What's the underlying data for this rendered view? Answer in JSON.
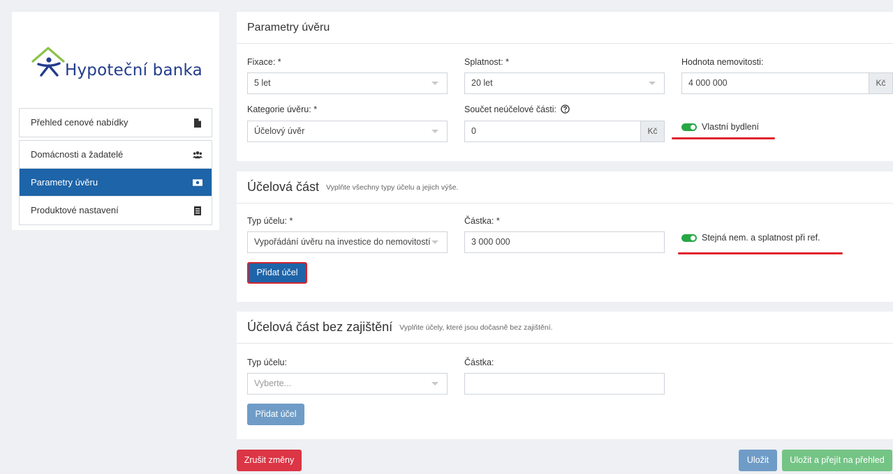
{
  "brand": {
    "name": "Hypoteční banka"
  },
  "sidebar": {
    "overview": {
      "label": "Přehled cenové nabídky",
      "icon": "document-icon"
    },
    "items": [
      {
        "label": "Domácnosti a žadatelé",
        "icon": "users-icon"
      },
      {
        "label": "Parametry úvěru",
        "icon": "money-icon",
        "active": true
      },
      {
        "label": "Produktové nastavení",
        "icon": "list-document-icon"
      }
    ]
  },
  "params": {
    "title": "Parametry úvěru",
    "fixace": {
      "label": "Fixace: *",
      "value": "5 let"
    },
    "splatnost": {
      "label": "Splatnost: *",
      "value": "20 let"
    },
    "hodnota": {
      "label": "Hodnota nemovitosti:",
      "value": "4 000 000",
      "currency": "Kč"
    },
    "kategorie": {
      "label": "Kategorie úvěru: *",
      "value": "Účelový úvěr"
    },
    "soucet": {
      "label": "Součet neúčelové části:",
      "value": "0",
      "currency": "Kč"
    },
    "own_housing": {
      "label": "Vlastní bydlení",
      "on": true
    }
  },
  "purpose": {
    "title": "Účelová část",
    "subtitle": "Vyplňte všechny typy účelu a jejich výše.",
    "type": {
      "label": "Typ účelu: *",
      "value": "Vypořádání úvěru na investice do nemovitostí"
    },
    "amount": {
      "label": "Částka: *",
      "value": "3 000 000"
    },
    "same_toggle": {
      "label": "Stejná nem. a splatnost při ref.",
      "on": true
    },
    "add_button": "Přidat účel"
  },
  "unsecured": {
    "title": "Účelová část bez zajištění",
    "subtitle": "Vyplňte účely, které jsou dočasně bez zajištění.",
    "type": {
      "label": "Typ účelu:",
      "placeholder": "Vyberte..."
    },
    "amount": {
      "label": "Částka:",
      "value": ""
    },
    "add_button": "Přidat účel"
  },
  "footer": {
    "cancel": "Zrušit změny",
    "save": "Uložit",
    "save_continue": "Uložit a přejít na přehled"
  },
  "colors": {
    "primary": "#1e64a8",
    "danger": "#dc3545",
    "success": "#74c485",
    "toggle_on": "#28a745",
    "highlight": "#e0242e"
  }
}
